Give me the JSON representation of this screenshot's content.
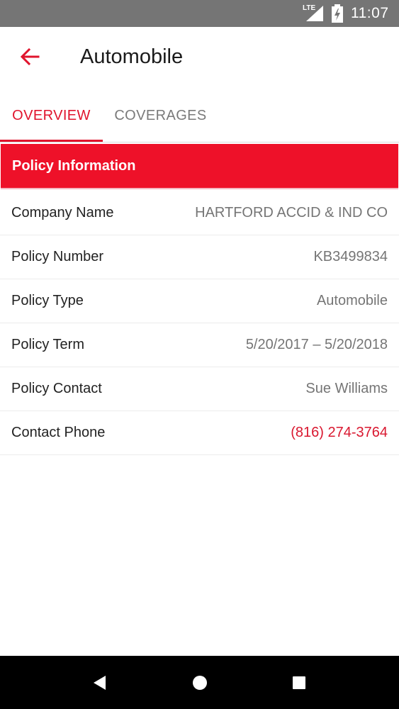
{
  "status_bar": {
    "network": "LTE",
    "time": "11:07"
  },
  "app_bar": {
    "title": "Automobile",
    "back_icon": "arrow-back-icon"
  },
  "tabs": [
    {
      "label": "OVERVIEW",
      "active": true
    },
    {
      "label": "COVERAGES",
      "active": false
    }
  ],
  "section": {
    "title": "Policy Information"
  },
  "rows": [
    {
      "label": "Company Name",
      "value": "HARTFORD ACCID & IND CO"
    },
    {
      "label": "Policy Number",
      "value": "KB3499834"
    },
    {
      "label": "Policy Type",
      "value": "Automobile"
    },
    {
      "label": "Policy Term",
      "value": "5/20/2017 – 5/20/2018"
    },
    {
      "label": "Policy Contact",
      "value": "Sue Williams"
    },
    {
      "label": "Contact Phone",
      "value": "(816) 274-3764"
    }
  ],
  "colors": {
    "accent": "#e0142d",
    "header_bg": "#ee1129",
    "status_bar_bg": "#757575",
    "nav_bar_bg": "#000000",
    "value_text": "#757575",
    "link_text": "#d9172f"
  }
}
